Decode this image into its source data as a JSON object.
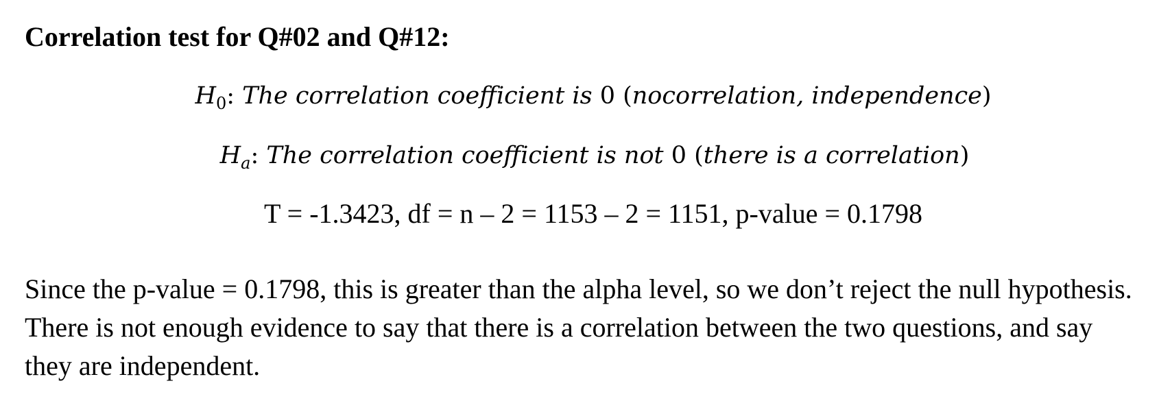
{
  "heading": "Correlation test for Q#02 and Q#12:",
  "h0": {
    "symbol": "H",
    "subscript": "0",
    "colon": ":",
    "text_before": " The correlation coefficient is ",
    "zero": "0",
    "paren_open": " (",
    "paren_text": "nocorrelation, independence",
    "paren_close": ")"
  },
  "ha": {
    "symbol": "H",
    "subscript": "a",
    "colon": ":",
    "text_before": " The correlation coefficient is not ",
    "zero": "0",
    "paren_open": " (",
    "paren_text": "there is a correlation",
    "paren_close": ")"
  },
  "stats_line": "T = -1.3423, df = n – 2 = 1153 – 2 = 1151, p-value = 0.1798",
  "conclusion": "Since the p-value = 0.1798, this is greater than the alpha level, so we don’t reject the null hypothesis. There is not enough evidence to say that there is a correlation between the two questions, and say they are independent."
}
